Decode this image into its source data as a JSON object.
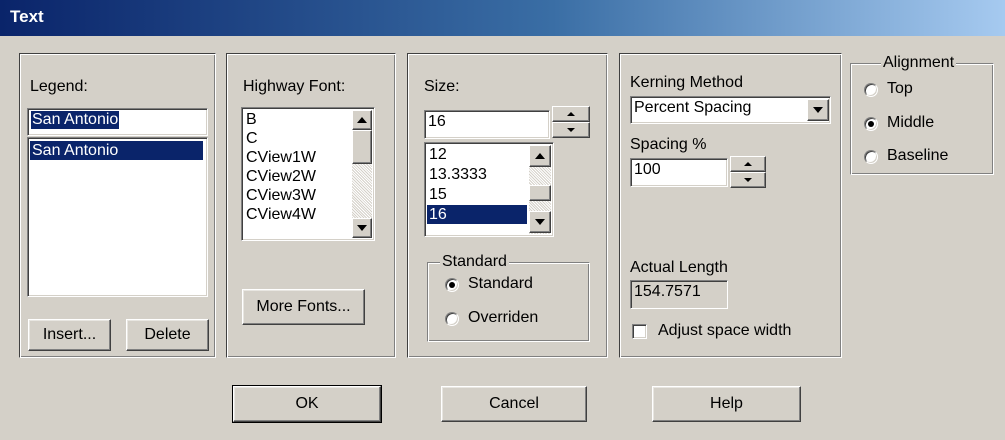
{
  "window": {
    "title": "Text"
  },
  "legend": {
    "label": "Legend:",
    "input_value": "San Antonio",
    "items": [
      "San Antonio"
    ],
    "insert_label": "Insert...",
    "delete_label": "Delete"
  },
  "highway_font": {
    "label": "Highway Font:",
    "items": [
      "B",
      "C",
      "CView1W",
      "CView2W",
      "CView3W",
      "CView4W"
    ],
    "more_fonts_label": "More Fonts..."
  },
  "size": {
    "label": "Size:",
    "value": "16",
    "items": [
      "12",
      "13.3333",
      "15",
      "16"
    ],
    "selected_index": 3,
    "group_title": "Standard",
    "options": [
      "Standard",
      "Overriden"
    ],
    "checked_index": 0
  },
  "kerning": {
    "method_label": "Kerning Method",
    "method_value": "Percent Spacing",
    "spacing_label": "Spacing %",
    "spacing_value": "100",
    "actual_length_label": "Actual Length",
    "actual_length_value": "154.7571",
    "adjust_label": "Adjust space width",
    "adjust_checked": false
  },
  "alignment": {
    "title": "Alignment",
    "options": [
      "Top",
      "Middle",
      "Baseline"
    ],
    "checked_index": 1
  },
  "buttons": {
    "ok": "OK",
    "cancel": "Cancel",
    "help": "Help"
  },
  "colors": {
    "title_start": "#0a246a",
    "title_end": "#a6caf0",
    "selection": "#0a246a",
    "face": "#d4d0c8"
  },
  "icons": {
    "scroll_up": "triangle-up",
    "scroll_down": "triangle-down",
    "dropdown": "triangle-down",
    "spin_up": "triangle-up",
    "spin_down": "triangle-down"
  }
}
